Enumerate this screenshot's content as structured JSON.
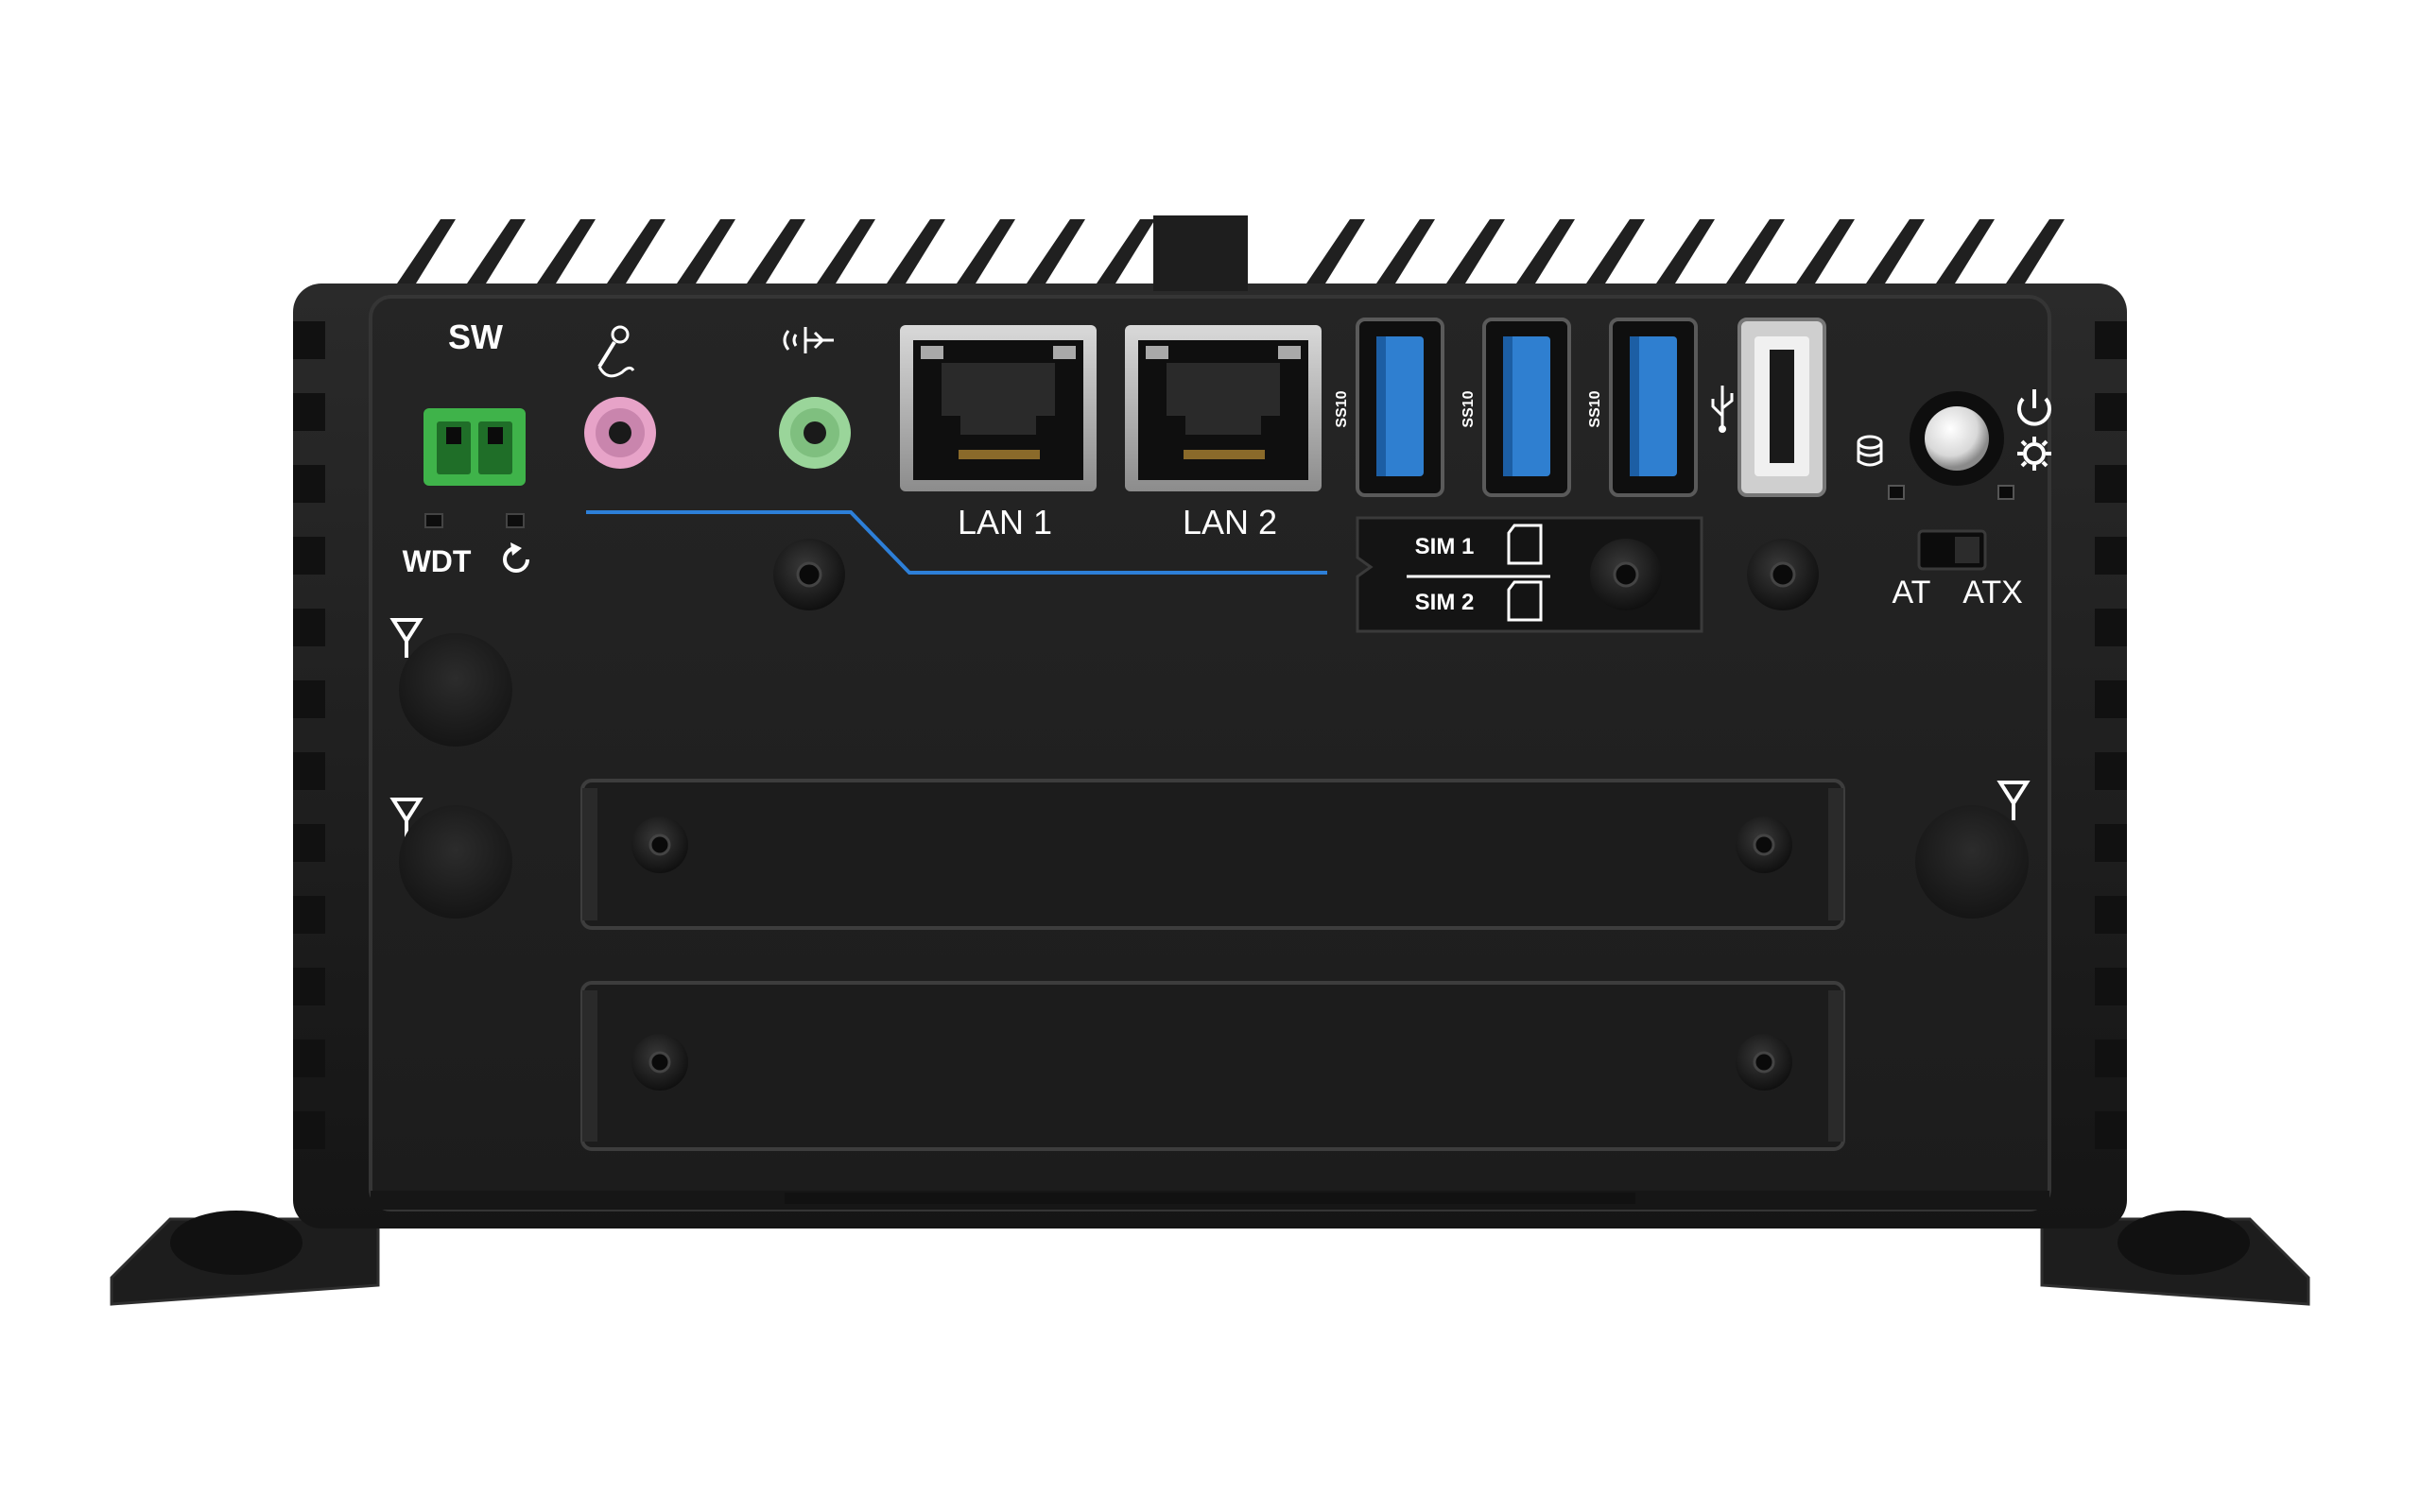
{
  "labels": {
    "sw": "SW",
    "wdt": "WDT",
    "lan1": "LAN 1",
    "lan2": "LAN 2",
    "sim1": "SIM 1",
    "sim2": "SIM 2",
    "at": "AT",
    "atx": "ATX",
    "usb_speed": "SS10"
  },
  "icons": {
    "microphone": "microphone-icon",
    "audio_out": "speaker-icon",
    "reset": "reset-icon",
    "usb": "usb-icon",
    "storage": "storage-icon",
    "power": "power-icon",
    "power_led": "gear-icon",
    "antenna": "antenna-icon"
  },
  "colors": {
    "chassis": "#1b1b1b",
    "panel": "#222222",
    "terminal_block": "#3fb34a",
    "mic_jack": "#e7a3c8",
    "line_out_jack": "#9ad59a",
    "usb3_tongue": "#2f7fd0",
    "accent_line": "#2d7fd8"
  }
}
